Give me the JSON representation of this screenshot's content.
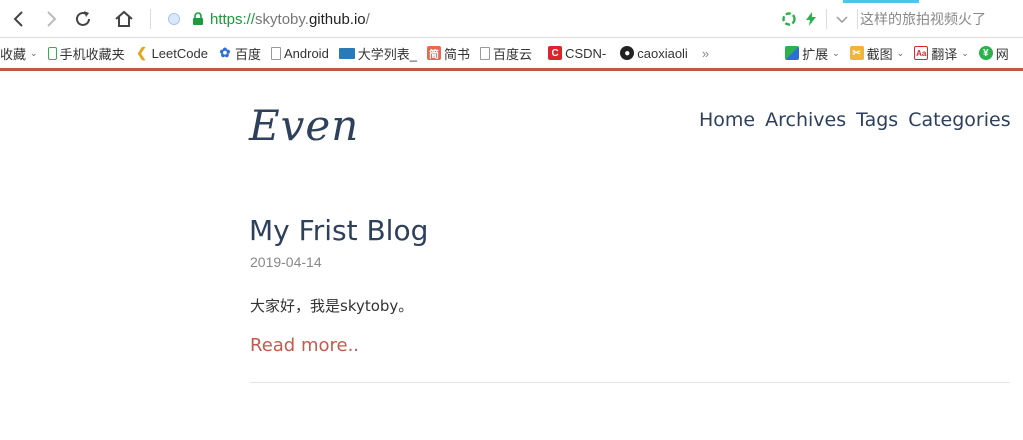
{
  "browser": {
    "address": {
      "protocol": "https://",
      "host_sub": "skytoby.",
      "host_main": "github.io",
      "path": "/"
    },
    "search_hint": "这样的旅拍视频火了",
    "colors": {
      "accent_line": "#c0554a",
      "secure_green": "#1a9b3c"
    }
  },
  "bookmarks": [
    {
      "label": "收藏",
      "icon": "none"
    },
    {
      "label": "手机收藏夹",
      "icon": "phone-icon"
    },
    {
      "label": "LeetCode",
      "icon": "leetcode-icon"
    },
    {
      "label": "百度",
      "icon": "baidu-paw-icon"
    },
    {
      "label": "Android",
      "icon": "page-icon"
    },
    {
      "label": "大学列表_",
      "icon": "folder-flag-icon"
    },
    {
      "label": "简书",
      "icon": "jianshu-icon"
    },
    {
      "label": "百度云",
      "icon": "page-icon"
    },
    {
      "label": "CSDN-",
      "icon": "csdn-icon"
    },
    {
      "label": "caoxiaoli",
      "icon": "github-icon"
    }
  ],
  "bookmark_tools": {
    "more": "»",
    "ext_label": "扩展",
    "screenshot_label": "截图",
    "translate_label": "翻译",
    "last_label": "网"
  },
  "site": {
    "logo": "Even",
    "menu": [
      "Home",
      "Archives",
      "Tags",
      "Categories"
    ]
  },
  "post": {
    "title": "My Frist Blog",
    "date": "2019-04-14",
    "excerpt": "大家好，我是skytoby。",
    "read_more": "Read more.."
  }
}
